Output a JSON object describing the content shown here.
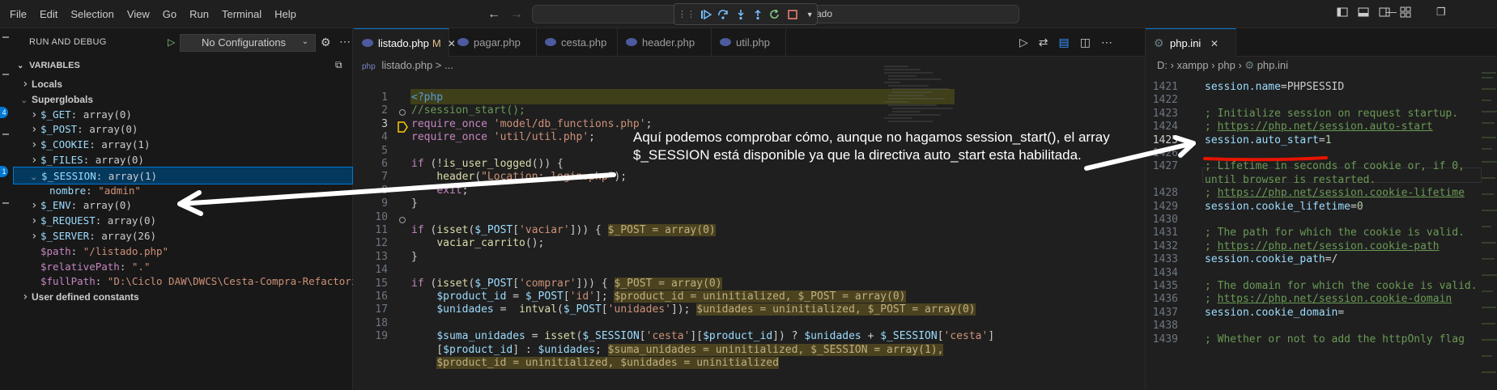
{
  "menu": [
    "File",
    "Edit",
    "Selection",
    "View",
    "Go",
    "Run",
    "Terminal",
    "Help"
  ],
  "command_center": {
    "text": "ado"
  },
  "debug_toolbar": {
    "icons": [
      "gripper-icon",
      "continue-icon",
      "step-over-icon",
      "step-into-icon",
      "step-out-icon",
      "restart-icon",
      "stop-icon"
    ]
  },
  "activity": {
    "badges": [
      "4",
      "1"
    ]
  },
  "sidebar": {
    "title": "RUN AND DEBUG",
    "config": "No Configurations",
    "variables_header": "VARIABLES",
    "rows": [
      {
        "kind": "section",
        "indent": 1,
        "expanded": false,
        "label": "Locals"
      },
      {
        "kind": "section",
        "indent": 1,
        "expanded": true,
        "label": "Superglobals"
      },
      {
        "kind": "var",
        "indent": 2,
        "expanded": false,
        "name": "$_GET",
        "value": "array(0)"
      },
      {
        "kind": "var",
        "indent": 2,
        "expanded": false,
        "name": "$_POST",
        "value": "array(0)"
      },
      {
        "kind": "var",
        "indent": 2,
        "expanded": false,
        "name": "$_COOKIE",
        "value": "array(1)"
      },
      {
        "kind": "var",
        "indent": 2,
        "expanded": false,
        "name": "$_FILES",
        "value": "array(0)"
      },
      {
        "kind": "var",
        "indent": 2,
        "expanded": true,
        "selected": true,
        "name": "$_SESSION",
        "value": "array(1)"
      },
      {
        "kind": "leaf",
        "indent": 3,
        "name": "nombre",
        "value": "\"admin\""
      },
      {
        "kind": "var",
        "indent": 2,
        "expanded": false,
        "name": "$_ENV",
        "value": "array(0)"
      },
      {
        "kind": "var",
        "indent": 2,
        "expanded": false,
        "name": "$_REQUEST",
        "value": "array(0)"
      },
      {
        "kind": "var",
        "indent": 2,
        "expanded": false,
        "name": "$_SERVER",
        "value": "array(26)"
      },
      {
        "kind": "pvar",
        "indent": 2,
        "name": "$path",
        "value": "\"/listado.php\""
      },
      {
        "kind": "pvar",
        "indent": 2,
        "name": "$relativePath",
        "value": "\".\""
      },
      {
        "kind": "pvar",
        "indent": 2,
        "name": "$fullPath",
        "value": "\"D:\\Ciclo DAW\\DWCS\\Cesta-Compra-Refactorin"
      },
      {
        "kind": "section",
        "indent": 1,
        "expanded": false,
        "label": "User defined constants"
      }
    ]
  },
  "editor1": {
    "tabs": [
      {
        "label": "listado.php",
        "modified": "M",
        "active": true
      },
      {
        "label": "pagar.php"
      },
      {
        "label": "cesta.php"
      },
      {
        "label": "header.php"
      },
      {
        "label": "util.php"
      }
    ],
    "breadcrumb": "listado.php > ...",
    "lines": [
      {
        "n": "1",
        "tokens": [
          [
            "tag",
            "<?php"
          ]
        ]
      },
      {
        "n": "2",
        "tokens": [
          [
            "cmt",
            "//session_start();"
          ]
        ]
      },
      {
        "n": "3",
        "tokens": [
          [
            "kw2",
            "require_once"
          ],
          [
            "",
            " "
          ],
          [
            "str",
            "'model/db_functions.php'"
          ],
          [
            "",
            ";"
          ]
        ]
      },
      {
        "n": "4",
        "tokens": [
          [
            "kw2",
            "require_once"
          ],
          [
            "",
            " "
          ],
          [
            "str",
            "'util/util.php'"
          ],
          [
            "",
            ";"
          ]
        ]
      },
      {
        "n": "5",
        "tokens": []
      },
      {
        "n": "6",
        "tokens": [
          [
            "kw2",
            "if"
          ],
          [
            "",
            " (!"
          ],
          [
            "fn",
            "is_user_logged"
          ],
          [
            "",
            "()) {"
          ]
        ]
      },
      {
        "n": "7",
        "tokens": [
          [
            "",
            "    "
          ],
          [
            "fn",
            "header"
          ],
          [
            "",
            "("
          ],
          [
            "str",
            "\"Location: login.php\""
          ],
          [
            "",
            ");"
          ]
        ]
      },
      {
        "n": "8",
        "tokens": [
          [
            "",
            "    "
          ],
          [
            "kw2",
            "exit"
          ],
          [
            "",
            ";"
          ]
        ]
      },
      {
        "n": "9",
        "tokens": [
          [
            "",
            "}"
          ]
        ]
      },
      {
        "n": "10",
        "tokens": []
      },
      {
        "n": "11",
        "tokens": [
          [
            "kw2",
            "if"
          ],
          [
            "",
            " ("
          ],
          [
            "fn",
            "isset"
          ],
          [
            "",
            "("
          ],
          [
            "var",
            "$_POST"
          ],
          [
            "",
            "["
          ],
          [
            "str",
            "'vaciar'"
          ],
          [
            "",
            "])) { "
          ],
          [
            "inl",
            "$_POST = array(0)"
          ]
        ]
      },
      {
        "n": "12",
        "tokens": [
          [
            "",
            "    "
          ],
          [
            "fn",
            "vaciar_carrito"
          ],
          [
            "",
            "();"
          ]
        ]
      },
      {
        "n": "13",
        "tokens": [
          [
            "",
            "}"
          ]
        ]
      },
      {
        "n": "14",
        "tokens": []
      },
      {
        "n": "15",
        "tokens": [
          [
            "kw2",
            "if"
          ],
          [
            "",
            " ("
          ],
          [
            "fn",
            "isset"
          ],
          [
            "",
            "("
          ],
          [
            "var",
            "$_POST"
          ],
          [
            "",
            "["
          ],
          [
            "str",
            "'comprar'"
          ],
          [
            "",
            "])) { "
          ],
          [
            "inl",
            "$_POST = array(0)"
          ]
        ]
      },
      {
        "n": "16",
        "tokens": [
          [
            "",
            "    "
          ],
          [
            "var",
            "$product_id"
          ],
          [
            "",
            " = "
          ],
          [
            "var",
            "$_POST"
          ],
          [
            "",
            "["
          ],
          [
            "str",
            "'id'"
          ],
          [
            "",
            "]; "
          ],
          [
            "inl",
            "$product_id = uninitialized, $_POST = array(0)"
          ]
        ]
      },
      {
        "n": "17",
        "tokens": [
          [
            "",
            "    "
          ],
          [
            "var",
            "$unidades"
          ],
          [
            "",
            " =  "
          ],
          [
            "fn",
            "intval"
          ],
          [
            "",
            "("
          ],
          [
            "var",
            "$_POST"
          ],
          [
            "",
            "["
          ],
          [
            "str",
            "'unidades'"
          ],
          [
            "",
            "]); "
          ],
          [
            "inl",
            "$unidades = uninitialized, $_POST = array(0)"
          ]
        ]
      },
      {
        "n": "18",
        "tokens": []
      },
      {
        "n": "19",
        "tokens": [
          [
            "",
            "    "
          ],
          [
            "var",
            "$suma_unidades"
          ],
          [
            "",
            " = "
          ],
          [
            "fn",
            "isset"
          ],
          [
            "",
            "("
          ],
          [
            "var",
            "$_SESSION"
          ],
          [
            "",
            "["
          ],
          [
            "str",
            "'cesta'"
          ],
          [
            "",
            "]["
          ],
          [
            "var",
            "$product_id"
          ],
          [
            "",
            "]) ? "
          ],
          [
            "var",
            "$unidades"
          ],
          [
            "",
            " + "
          ],
          [
            "var",
            "$_SESSION"
          ],
          [
            "",
            "["
          ],
          [
            "str",
            "'cesta'"
          ],
          [
            "",
            "]"
          ]
        ]
      },
      {
        "n": "",
        "tokens": [
          [
            "",
            "    ["
          ],
          [
            "var",
            "$product_id"
          ],
          [
            "",
            "] : "
          ],
          [
            "var",
            "$unidades"
          ],
          [
            "",
            "; "
          ],
          [
            "inl",
            "$suma_unidades = uninitialized, $_SESSION = array(1),"
          ]
        ]
      },
      {
        "n": "",
        "tokens": [
          [
            "",
            "    "
          ],
          [
            "inl",
            "$product_id = uninitialized, $unidades = uninitialized"
          ]
        ]
      }
    ]
  },
  "editor2": {
    "tab": "php.ini",
    "breadcrumb": [
      "D:",
      "xampp",
      "php",
      "php.ini"
    ],
    "lines": [
      {
        "n": "1421",
        "tokens": [
          [
            "key",
            "session.name"
          ],
          [
            "eq",
            "="
          ],
          [
            "val",
            "PHPSESSID"
          ]
        ]
      },
      {
        "n": "1422",
        "tokens": []
      },
      {
        "n": "1423",
        "tokens": [
          [
            "cmt",
            "; Initialize session on request startup."
          ]
        ]
      },
      {
        "n": "1424",
        "tokens": [
          [
            "cmt",
            "; "
          ],
          [
            "link",
            "https://php.net/session.auto-start"
          ]
        ]
      },
      {
        "n": "1425",
        "current": true,
        "tokens": [
          [
            "key",
            "session.auto_start"
          ],
          [
            "eq",
            "="
          ],
          [
            "num",
            "1"
          ]
        ]
      },
      {
        "n": "1426",
        "tokens": []
      },
      {
        "n": "1427",
        "tokens": [
          [
            "cmt",
            "; Lifetime in seconds of cookie or, if 0,"
          ]
        ]
      },
      {
        "n": "",
        "tokens": [
          [
            "cmt",
            "until browser is restarted."
          ]
        ]
      },
      {
        "n": "1428",
        "tokens": [
          [
            "cmt",
            "; "
          ],
          [
            "link",
            "https://php.net/session.cookie-lifetime"
          ]
        ]
      },
      {
        "n": "1429",
        "tokens": [
          [
            "key",
            "session.cookie_lifetime"
          ],
          [
            "eq",
            "="
          ],
          [
            "num",
            "0"
          ]
        ]
      },
      {
        "n": "1430",
        "tokens": []
      },
      {
        "n": "1431",
        "tokens": [
          [
            "cmt",
            "; The path for which the cookie is valid."
          ]
        ]
      },
      {
        "n": "1432",
        "tokens": [
          [
            "cmt",
            "; "
          ],
          [
            "link",
            "https://php.net/session.cookie-path"
          ]
        ]
      },
      {
        "n": "1433",
        "tokens": [
          [
            "key",
            "session.cookie_path"
          ],
          [
            "eq",
            "="
          ],
          [
            "val",
            "/"
          ]
        ]
      },
      {
        "n": "1434",
        "tokens": []
      },
      {
        "n": "1435",
        "tokens": [
          [
            "cmt",
            "; The domain for which the cookie is valid."
          ]
        ]
      },
      {
        "n": "1436",
        "tokens": [
          [
            "cmt",
            "; "
          ],
          [
            "link",
            "https://php.net/session.cookie-domain"
          ]
        ]
      },
      {
        "n": "1437",
        "tokens": [
          [
            "key",
            "session.cookie_domain"
          ],
          [
            "eq",
            "="
          ]
        ]
      },
      {
        "n": "1438",
        "tokens": []
      },
      {
        "n": "1439",
        "tokens": [
          [
            "cmt",
            "; Whether or not to add the httpOnly flag"
          ]
        ]
      }
    ]
  },
  "annotation": "Aquí podemos comprobar cómo, aunque no hagamos session_start(), el array $_SESSION está disponible ya que la directiva auto_start esta habilitada.",
  "colors": {
    "accent": "#0078d4",
    "annotation_arrow": "#ffffff",
    "underline": "#e51400"
  }
}
